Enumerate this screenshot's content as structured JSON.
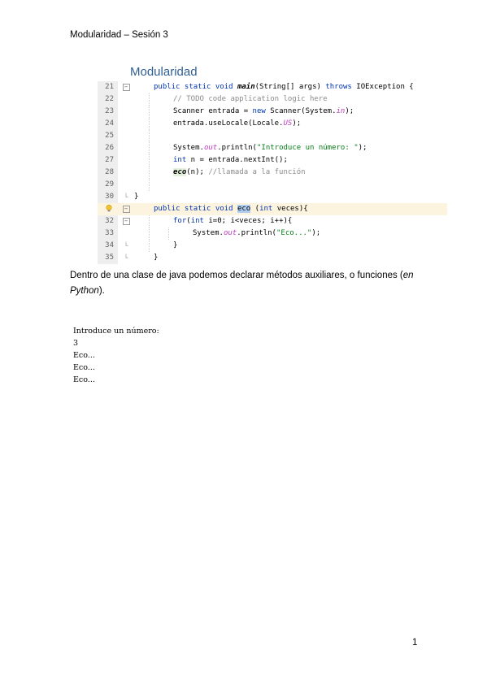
{
  "header": {
    "title": "Modularidad – Sesión 3"
  },
  "section": {
    "title": "Modularidad"
  },
  "code": {
    "lines": [
      {
        "num": "21",
        "fold": "minus",
        "indent": 1,
        "segments": [
          {
            "text": "public static void ",
            "cls": "kw"
          },
          {
            "text": "main",
            "cls": "mt"
          },
          {
            "text": "(String[] args) ",
            "cls": ""
          },
          {
            "text": "throws",
            "cls": "kw"
          },
          {
            "text": " IOException {",
            "cls": ""
          }
        ]
      },
      {
        "num": "22",
        "fold": "",
        "indent": 2,
        "segments": [
          {
            "text": "// TODO code application logic here",
            "cls": "cm"
          }
        ]
      },
      {
        "num": "23",
        "fold": "",
        "indent": 2,
        "segments": [
          {
            "text": "Scanner entrada = ",
            "cls": ""
          },
          {
            "text": "new",
            "cls": "kw"
          },
          {
            "text": " Scanner(System.",
            "cls": ""
          },
          {
            "text": "in",
            "cls": "fld"
          },
          {
            "text": ");",
            "cls": ""
          }
        ]
      },
      {
        "num": "24",
        "fold": "",
        "indent": 2,
        "segments": [
          {
            "text": "entrada.useLocale(Locale.",
            "cls": ""
          },
          {
            "text": "US",
            "cls": "fld"
          },
          {
            "text": ");",
            "cls": ""
          }
        ]
      },
      {
        "num": "25",
        "fold": "",
        "indent": 2,
        "segments": []
      },
      {
        "num": "26",
        "fold": "",
        "indent": 2,
        "segments": [
          {
            "text": "System.",
            "cls": ""
          },
          {
            "text": "out",
            "cls": "fld"
          },
          {
            "text": ".println(",
            "cls": ""
          },
          {
            "text": "\"Introduce un número: \"",
            "cls": "st"
          },
          {
            "text": ");",
            "cls": ""
          }
        ]
      },
      {
        "num": "27",
        "fold": "",
        "indent": 2,
        "segments": [
          {
            "text": "int",
            "cls": "kw"
          },
          {
            "text": " n = entrada.nextInt();",
            "cls": ""
          }
        ]
      },
      {
        "num": "28",
        "fold": "",
        "indent": 2,
        "segments": [
          {
            "text": "eco",
            "cls": "mt callhl"
          },
          {
            "text": "(n); ",
            "cls": ""
          },
          {
            "text": "//llamada a la función",
            "cls": "cm"
          }
        ]
      },
      {
        "num": "29",
        "fold": "",
        "indent": 2,
        "segments": []
      },
      {
        "num": "30",
        "fold": "end",
        "indent": 0,
        "segments": [
          {
            "text": "}",
            "cls": ""
          }
        ]
      },
      {
        "num": "",
        "fold": "minus",
        "indent": 1,
        "bulb": true,
        "highlight": true,
        "segments": [
          {
            "text": "public static void ",
            "cls": "kw"
          },
          {
            "text": "eco",
            "cls": "sel"
          },
          {
            "text": " (",
            "cls": ""
          },
          {
            "text": "int",
            "cls": "kw"
          },
          {
            "text": " veces){",
            "cls": ""
          }
        ]
      },
      {
        "num": "32",
        "fold": "minus",
        "indent": 2,
        "segments": [
          {
            "text": "for",
            "cls": "kw"
          },
          {
            "text": "(",
            "cls": ""
          },
          {
            "text": "int",
            "cls": "kw"
          },
          {
            "text": " i=0; i<veces; i++){",
            "cls": ""
          }
        ]
      },
      {
        "num": "33",
        "fold": "",
        "indent": 3,
        "segments": [
          {
            "text": "System.",
            "cls": ""
          },
          {
            "text": "out",
            "cls": "fld"
          },
          {
            "text": ".println(",
            "cls": ""
          },
          {
            "text": "\"Eco...\"",
            "cls": "st"
          },
          {
            "text": ");",
            "cls": ""
          }
        ]
      },
      {
        "num": "34",
        "fold": "end",
        "indent": 2,
        "segments": [
          {
            "text": "}",
            "cls": ""
          }
        ]
      },
      {
        "num": "35",
        "fold": "end",
        "indent": 1,
        "segments": [
          {
            "text": "}",
            "cls": ""
          }
        ]
      }
    ]
  },
  "paragraph": {
    "text_before": "Dentro de una clase de java podemos declarar métodos auxiliares, o funciones (",
    "italic": "en Python",
    "text_after": ")."
  },
  "output": {
    "lines": [
      "Introduce un número:",
      "3",
      "Eco...",
      "Eco...",
      "Eco..."
    ]
  },
  "page_number": "1"
}
